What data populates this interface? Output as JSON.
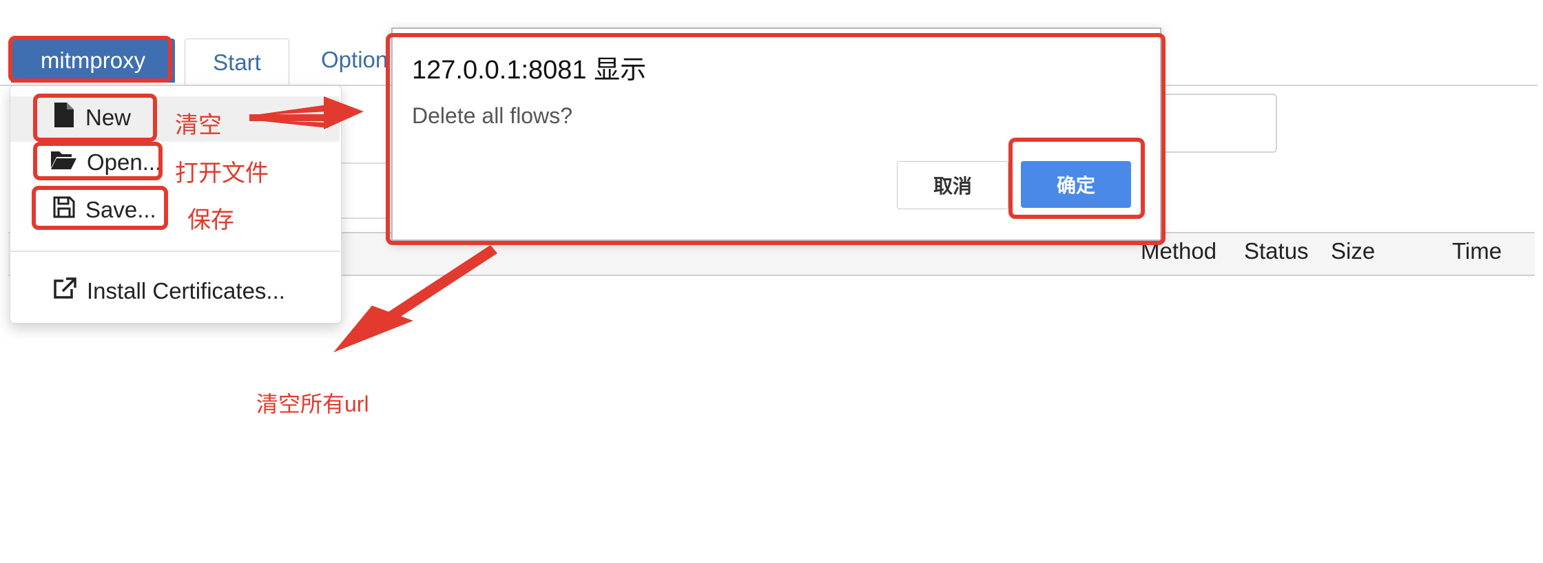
{
  "nav": {
    "brand": "mitmproxy",
    "tabs": [
      {
        "label": "Start"
      },
      {
        "label": "Option"
      }
    ]
  },
  "menu": {
    "items": [
      {
        "label": "New",
        "icon": "file-icon"
      },
      {
        "label": "Open...",
        "icon": "folder-open-icon"
      },
      {
        "label": "Save...",
        "icon": "floppy-disk-icon"
      },
      {
        "label": "Install Certificates...",
        "icon": "external-link-icon"
      }
    ]
  },
  "dialog": {
    "title": "127.0.0.1:8081 显示",
    "message": "Delete all flows?",
    "cancel": "取消",
    "confirm": "确定"
  },
  "table": {
    "columns": [
      "Method",
      "Status",
      "Size",
      "Time"
    ]
  },
  "annotations": {
    "new": "清空",
    "open": "打开文件",
    "save": "保存",
    "delete_all": "清空所有url",
    "color": "#e23a2e"
  },
  "colors": {
    "brand_tab": "#3f6fb0",
    "link": "#3a6ea5",
    "confirm_button": "#4a89e8"
  }
}
